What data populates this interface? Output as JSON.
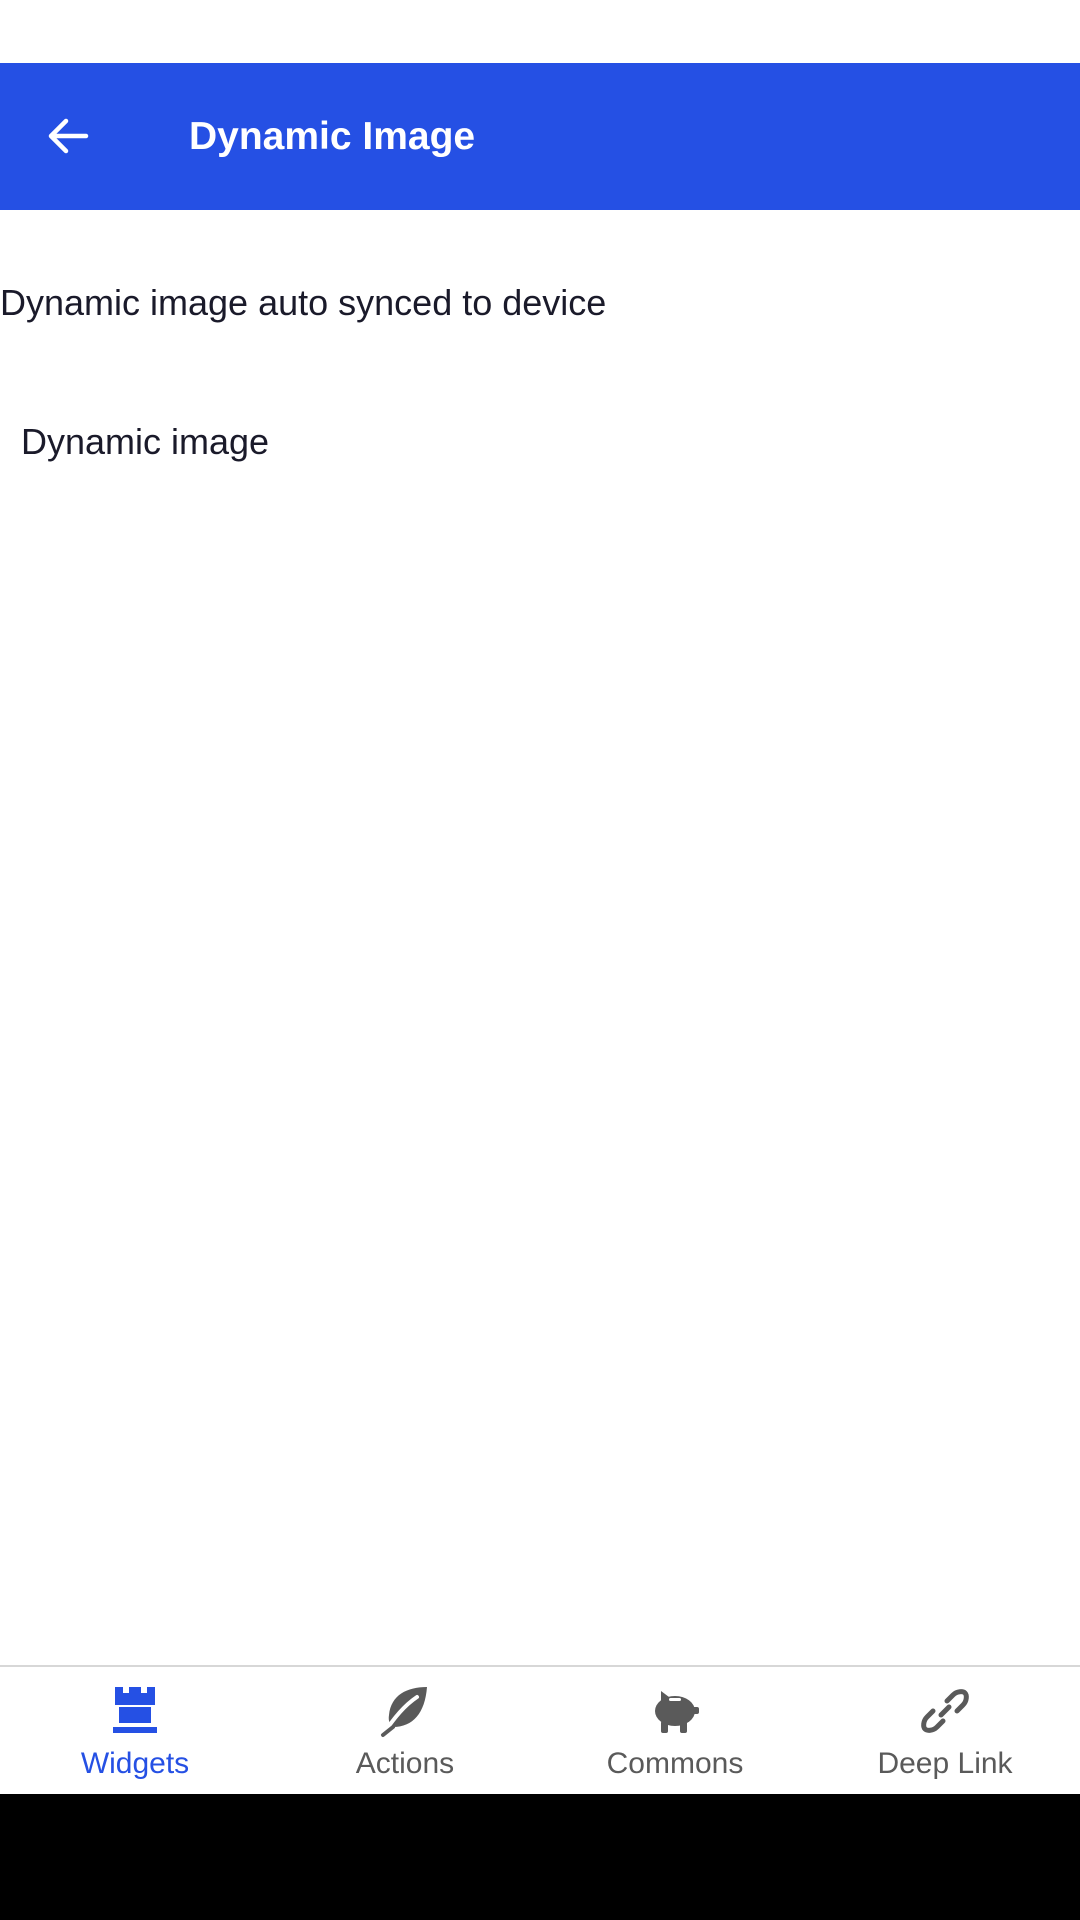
{
  "app_bar": {
    "title": "Dynamic Image",
    "back_icon": "arrow-left-icon",
    "color": "#2550E4"
  },
  "content": {
    "subtitle": "Dynamic image auto synced to device",
    "image_label": "Dynamic image"
  },
  "bottom_nav": {
    "active_color": "#2550E4",
    "inactive_color": "#5a5a5a",
    "items": [
      {
        "label": "Widgets",
        "icon": "chess-rook-icon",
        "active": true
      },
      {
        "label": "Actions",
        "icon": "leaf-icon",
        "active": false
      },
      {
        "label": "Commons",
        "icon": "piggy-bank-icon",
        "active": false
      },
      {
        "label": "Deep Link",
        "icon": "link-icon",
        "active": false
      }
    ]
  }
}
